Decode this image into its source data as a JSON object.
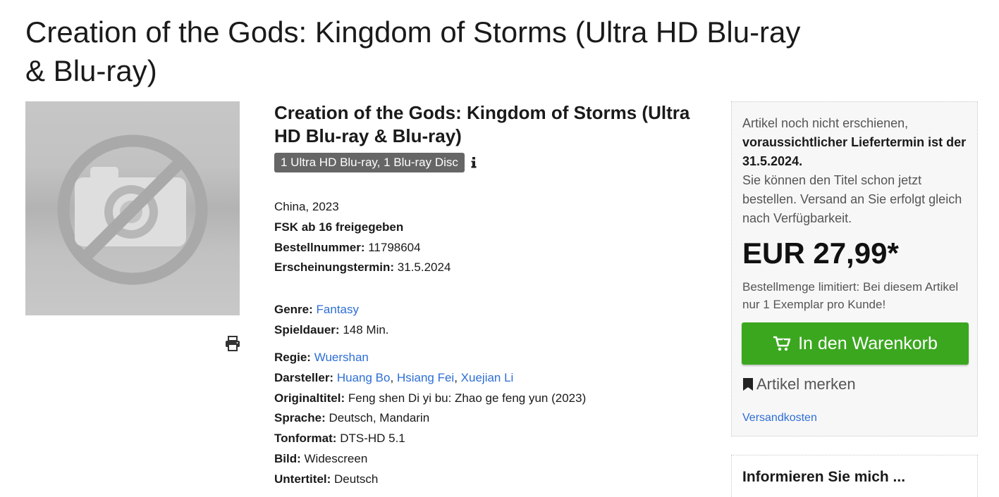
{
  "page_title": "Creation of the Gods: Kingdom of Storms (Ultra HD Blu-ray & Blu-ray)",
  "product": {
    "image_icon": "no-photo-icon",
    "print_icon": "printer-icon",
    "subtitle": "Creation of the Gods: Kingdom of Storms (Ultra HD Blu-ray & Blu-ray)",
    "format_badge": "1 Ultra HD Blu-ray, 1 Blu-ray Disc",
    "info_icon": "info-icon",
    "country_year": "China, 2023",
    "fsk": "FSK ab 16 freigegeben",
    "order_number": {
      "label": "Bestellnummer:",
      "value": "11798604"
    },
    "release_date": {
      "label": "Erscheinungstermin:",
      "value": "31.5.2024"
    },
    "genre": {
      "label": "Genre:",
      "value": "Fantasy"
    },
    "runtime": {
      "label": "Spieldauer:",
      "value": "148 Min."
    },
    "director": {
      "label": "Regie:",
      "value": "Wuershan"
    },
    "cast": {
      "label": "Darsteller:",
      "actors": [
        "Huang Bo",
        "Hsiang Fei",
        "Xuejian Li"
      ],
      "separator": ","
    },
    "original_title": {
      "label": "Originaltitel:",
      "value": "Feng shen Di yi bu: Zhao ge feng yun (2023)"
    },
    "language": {
      "label": "Sprache:",
      "value": "Deutsch, Mandarin"
    },
    "audio": {
      "label": "Tonformat:",
      "value": "DTS-HD 5.1"
    },
    "picture": {
      "label": "Bild:",
      "value": "Widescreen"
    },
    "subtitles": {
      "label": "Untertitel:",
      "value": "Deutsch"
    }
  },
  "buybox": {
    "availability_line1": "Artikel noch nicht erschienen,",
    "availability_bold": "voraussichtlicher Liefertermin ist der 31.5.2024.",
    "availability_line2": "Sie können den Titel schon jetzt bestellen. Versand an Sie erfolgt gleich nach Verfügbarkeit.",
    "price": "EUR 27,99*",
    "limit_note": "Bestellmenge limitiert: Bei diesem Artikel nur 1 Exemplar pro Kunde!",
    "cart_button": "In den Warenkorb",
    "cart_icon": "cart-plus-icon",
    "remember_label": "Artikel merken",
    "remember_icon": "bookmark-icon",
    "shipping_link": "Versandkosten"
  },
  "inform_box": {
    "title": "Informieren Sie mich ..."
  },
  "colors": {
    "link": "#2d6ed6",
    "cart_button": "#3ba71f",
    "badge": "#666666"
  }
}
